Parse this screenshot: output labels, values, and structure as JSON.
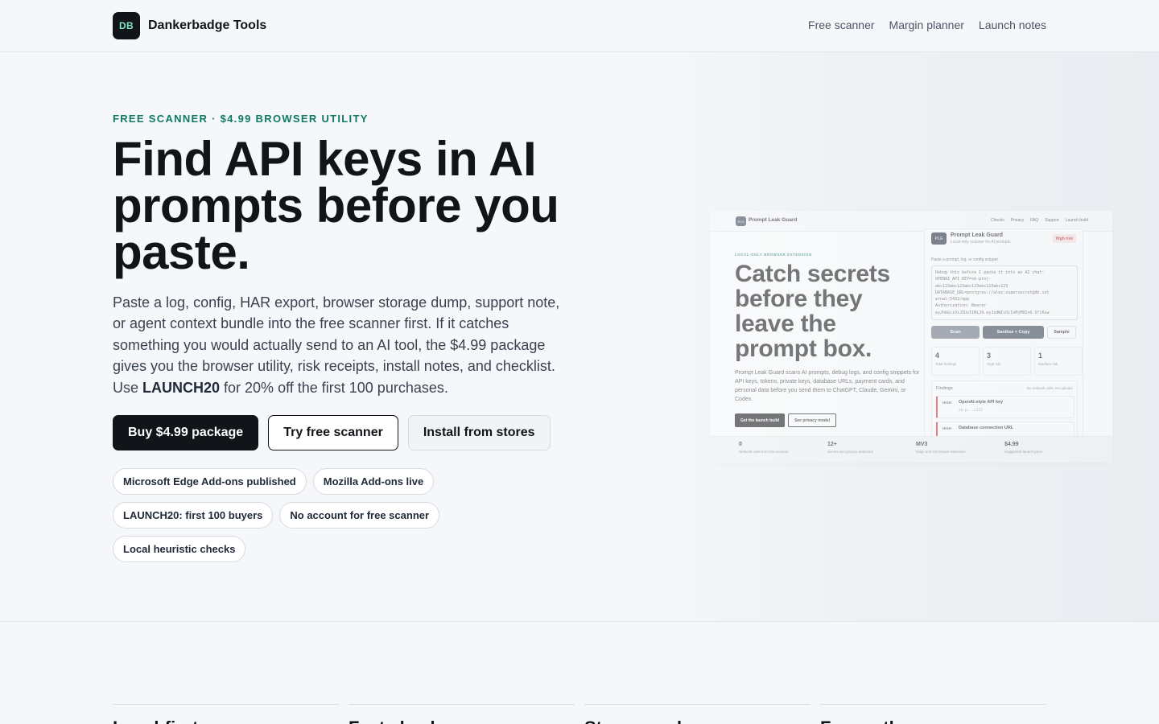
{
  "header": {
    "logo_text": "DB",
    "brand_name": "Dankerbadge Tools",
    "nav": [
      "Free scanner",
      "Margin planner",
      "Launch notes"
    ]
  },
  "hero": {
    "eyebrow": "FREE SCANNER · $4.99 BROWSER UTILITY",
    "headline": "Find API keys in AI prompts before you paste.",
    "lead_before": "Paste a log, config, HAR export, browser storage dump, support note, or agent context bundle into the free scanner first. If it catches something you would actually send to an AI tool, the $4.99 package gives you the browser utility, risk receipts, install notes, and checklist. Use ",
    "lead_code": "LAUNCH20",
    "lead_after": " for 20% off the first 100 purchases.",
    "buttons": {
      "buy": "Buy $4.99 package",
      "try": "Try free scanner",
      "install": "Install from stores"
    },
    "chips": [
      "Microsoft Edge Add-ons published",
      "Mozilla Add-ons live",
      "LAUNCH20: first 100 buyers",
      "No account for free scanner",
      "Local heuristic checks"
    ]
  },
  "preview": {
    "logo": "PLG",
    "brand": "Prompt Leak Guard",
    "nav": [
      "Checks",
      "Privacy",
      "FAQ",
      "Support",
      "Launch build"
    ],
    "eyebrow": "LOCAL-ONLY BROWSER EXTENSION",
    "headline": "Catch secrets before they leave the prompt box.",
    "body": "Prompt Leak Guard scans AI prompts, debug logs, and config snippets for API keys, tokens, private keys, database URLs, payment cards, and personal data before you send them to ChatGPT, Claude, Gemini, or Codex.",
    "btn_primary": "Get the launch build",
    "btn_secondary": "See privacy model",
    "card": {
      "title": "Prompt Leak Guard",
      "subtitle": "Local-only scanner for AI prompts.",
      "risk": "High risk",
      "input_label": "Paste a prompt, log, or config snippet",
      "input_text": "Debug this before I paste it into an AI chat:\nOPENAI_API_KEY=sk-proj-\nabc123abc123abc123abc123abc123\nDATABASE_URL=postgres://alex:supersecret@db.int\nernal:5432/app\nAuthorization: Bearer\neyJhbGciOiJIUzI1NiJ9.eyJzdWIiOiIxMjM0In0.SflKxw",
      "actions": [
        "Scan",
        "Sanitize + Copy",
        "Sample"
      ],
      "stats": [
        {
          "value": "4",
          "label": "Total findings"
        },
        {
          "value": "3",
          "label": "High risk"
        },
        {
          "value": "1",
          "label": "Medium risk"
        }
      ],
      "findings_title": "Findings",
      "findings_note": "No network calls. No upload.",
      "findings": [
        {
          "tag": "HIGH",
          "title": "OpenAI-style API key",
          "value": "sk-p...c123"
        },
        {
          "tag": "HIGH",
          "title": "Database connection URL",
          "value": ""
        }
      ]
    },
    "kpis": [
      {
        "value": "0",
        "label": "Network calls from the scanner"
      },
      {
        "value": "12+",
        "label": "Secret and privacy detectors"
      },
      {
        "value": "MV3",
        "label": "Edge and Chromium extension"
      },
      {
        "value": "$4.99",
        "label": "Suggested launch price"
      }
    ]
  },
  "features": [
    "Local-first",
    "Fast check",
    "Stores ready",
    "Free path"
  ],
  "colors": {
    "accent": "#0f7a62",
    "ink": "#111418",
    "logo_text": "#7ee6c7"
  }
}
